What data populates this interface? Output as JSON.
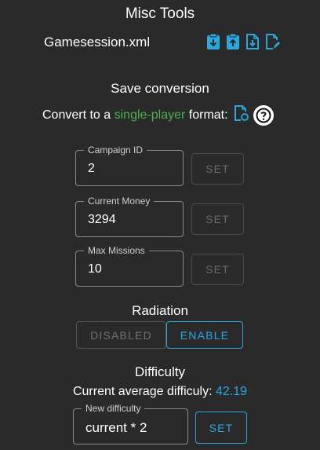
{
  "header": {
    "title": "Misc Tools"
  },
  "file": {
    "name": "Gamesession.xml",
    "actions": [
      "clipboard-down-icon",
      "clipboard-up-icon",
      "file-download-icon",
      "file-edit-icon"
    ]
  },
  "save_conversion": {
    "heading": "Save conversion",
    "text_prefix": "Convert to a ",
    "text_highlight": "single-player",
    "text_suffix": " format:",
    "highlight_color": "#4caf50"
  },
  "fields": {
    "campaign_id": {
      "label": "Campaign ID",
      "value": "2",
      "button": "SET"
    },
    "current_money": {
      "label": "Current Money",
      "value": "3294",
      "button": "SET"
    },
    "max_missions": {
      "label": "Max Missions",
      "value": "10",
      "button": "SET"
    }
  },
  "radiation": {
    "heading": "Radiation",
    "disabled_label": "DISABLED",
    "enable_label": "ENABLE"
  },
  "difficulty": {
    "heading": "Difficulty",
    "avg_label": "Current average difficuly:",
    "avg_value": "42.19",
    "new_label": "New difficulty",
    "new_value": "current * 2",
    "button": "SET"
  },
  "colors": {
    "accent": "#29a8e0",
    "background": "#2a2a2a"
  }
}
